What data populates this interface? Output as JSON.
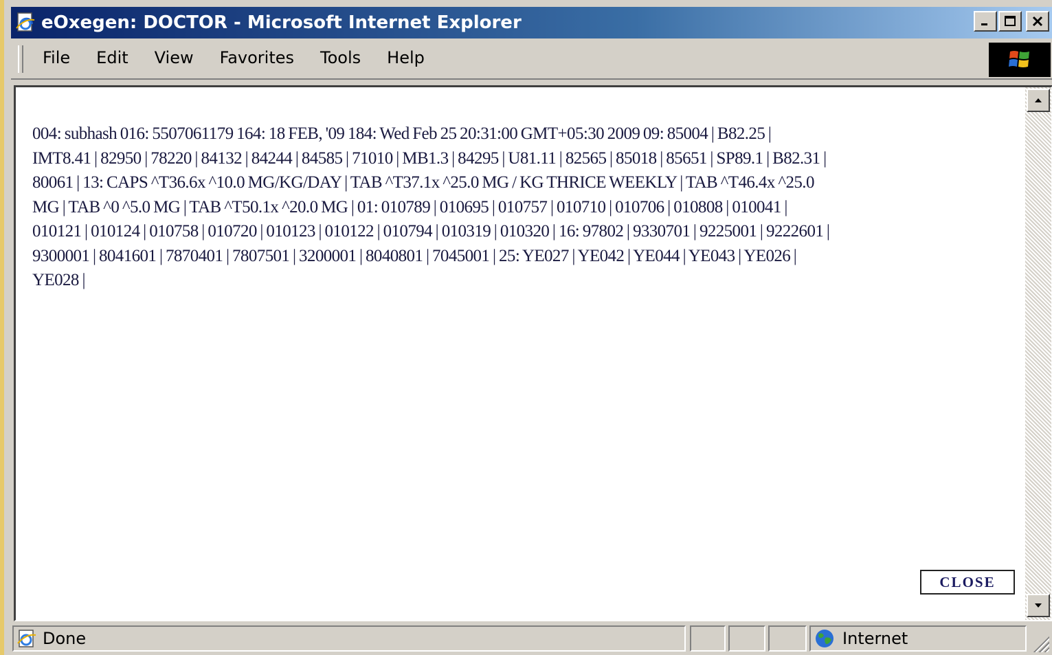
{
  "window": {
    "title": "eOxegen: DOCTOR - Microsoft Internet Explorer",
    "icon": "ie-page-icon",
    "controls": [
      "minimize-icon",
      "maximize-icon",
      "close-icon"
    ]
  },
  "menubar": {
    "items": [
      {
        "label": "File"
      },
      {
        "label": "Edit"
      },
      {
        "label": "View"
      },
      {
        "label": "Favorites"
      },
      {
        "label": "Tools"
      },
      {
        "label": "Help"
      }
    ],
    "throbber_icon": "windows-logo-icon"
  },
  "page": {
    "text_lines": [
      "004: subhash 016: 5507061179 164: 18 FEB, '09 184: Wed Feb 25 20:31:00 GMT+05:30 2009 09: 85004 | B82.25 |",
      "IMT8.41 | 82950 | 78220 | 84132 | 84244 | 84585 | 71010 | MB1.3 | 84295 | U81.11 | 82565 | 85018 | 85651 | SP89.1 | B82.31 |",
      "80061 | 13: CAPS ^T36.6x ^10.0 MG/KG/DAY | TAB ^T37.1x ^25.0 MG / KG THRICE WEEKLY | TAB ^T46.4x ^25.0",
      "MG | TAB ^0 ^5.0 MG | TAB ^T50.1x ^20.0 MG | 01: 010789 | 010695 | 010757 | 010710 | 010706 | 010808 | 010041 |",
      "010121 | 010124 | 010758 | 010720 | 010123 | 010122 | 010794 | 010319 | 010320 | 16: 97802 | 9330701 | 9225001 | 9222601 |",
      "9300001 | 8041601 | 7870401 | 7807501 | 3200001 | 8040801 | 7045001 | 25: YE027 | YE042 | YE044 | YE043 | YE026 |",
      "YE028 |"
    ],
    "close_button": "CLOSE"
  },
  "statusbar": {
    "status": "Done",
    "status_icon": "ie-page-done-icon",
    "zone": "Internet",
    "zone_icon": "globe-icon"
  }
}
